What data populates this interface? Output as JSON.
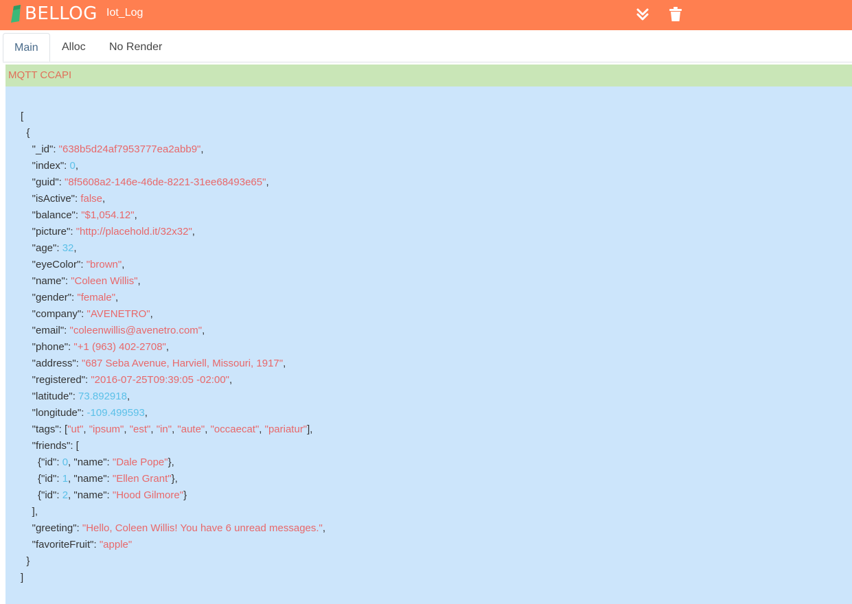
{
  "app": {
    "logo_text": "BELLOG",
    "title": "Iot_Log",
    "brand_color": "#ff7f50",
    "icons": {
      "scroll": "double-chevron-down-icon",
      "clear": "trash-icon"
    }
  },
  "tabs": [
    {
      "label": "Main",
      "active": true
    },
    {
      "label": "Alloc",
      "active": false
    },
    {
      "label": "No Render",
      "active": false
    }
  ],
  "panel": {
    "header": "MQTT CCAPI",
    "header_color": "#c9e6b7",
    "body_color": "#cce5fb"
  },
  "json_lines": [
    [
      {
        "t": "p",
        "v": "["
      }
    ],
    [
      {
        "t": "p",
        "v": "  {"
      }
    ],
    [
      {
        "t": "p",
        "v": "    \"_id\": "
      },
      {
        "t": "s",
        "v": "\"638b5d24af7953777ea2abb9\""
      },
      {
        "t": "p",
        "v": ","
      }
    ],
    [
      {
        "t": "p",
        "v": "    \"index\": "
      },
      {
        "t": "n",
        "v": "0"
      },
      {
        "t": "p",
        "v": ","
      }
    ],
    [
      {
        "t": "p",
        "v": "    \"guid\": "
      },
      {
        "t": "s",
        "v": "\"8f5608a2-146e-46de-8221-31ee68493e65\""
      },
      {
        "t": "p",
        "v": ","
      }
    ],
    [
      {
        "t": "p",
        "v": "    \"isActive\": "
      },
      {
        "t": "b",
        "v": "false"
      },
      {
        "t": "p",
        "v": ","
      }
    ],
    [
      {
        "t": "p",
        "v": "    \"balance\": "
      },
      {
        "t": "s",
        "v": "\"$1,054.12\""
      },
      {
        "t": "p",
        "v": ","
      }
    ],
    [
      {
        "t": "p",
        "v": "    \"picture\": "
      },
      {
        "t": "s",
        "v": "\"http://placehold.it/32x32\""
      },
      {
        "t": "p",
        "v": ","
      }
    ],
    [
      {
        "t": "p",
        "v": "    \"age\": "
      },
      {
        "t": "n",
        "v": "32"
      },
      {
        "t": "p",
        "v": ","
      }
    ],
    [
      {
        "t": "p",
        "v": "    \"eyeColor\": "
      },
      {
        "t": "s",
        "v": "\"brown\""
      },
      {
        "t": "p",
        "v": ","
      }
    ],
    [
      {
        "t": "p",
        "v": "    \"name\": "
      },
      {
        "t": "s",
        "v": "\"Coleen Willis\""
      },
      {
        "t": "p",
        "v": ","
      }
    ],
    [
      {
        "t": "p",
        "v": "    \"gender\": "
      },
      {
        "t": "s",
        "v": "\"female\""
      },
      {
        "t": "p",
        "v": ","
      }
    ],
    [
      {
        "t": "p",
        "v": "    \"company\": "
      },
      {
        "t": "s",
        "v": "\"AVENETRO\""
      },
      {
        "t": "p",
        "v": ","
      }
    ],
    [
      {
        "t": "p",
        "v": "    \"email\": "
      },
      {
        "t": "s",
        "v": "\"coleenwillis@avenetro.com\""
      },
      {
        "t": "p",
        "v": ","
      }
    ],
    [
      {
        "t": "p",
        "v": "    \"phone\": "
      },
      {
        "t": "s",
        "v": "\"+1 (963) 402-2708\""
      },
      {
        "t": "p",
        "v": ","
      }
    ],
    [
      {
        "t": "p",
        "v": "    \"address\": "
      },
      {
        "t": "s",
        "v": "\"687 Seba Avenue, Harviell, Missouri, 1917\""
      },
      {
        "t": "p",
        "v": ","
      }
    ],
    [
      {
        "t": "p",
        "v": "    \"registered\": "
      },
      {
        "t": "s",
        "v": "\"2016-07-25T09:39:05 -02:00\""
      },
      {
        "t": "p",
        "v": ","
      }
    ],
    [
      {
        "t": "p",
        "v": "    \"latitude\": "
      },
      {
        "t": "n",
        "v": "73.892918"
      },
      {
        "t": "p",
        "v": ","
      }
    ],
    [
      {
        "t": "p",
        "v": "    \"longitude\": "
      },
      {
        "t": "n",
        "v": "-109.499593"
      },
      {
        "t": "p",
        "v": ","
      }
    ],
    [
      {
        "t": "p",
        "v": "    \"tags\": ["
      },
      {
        "t": "s",
        "v": "\"ut\""
      },
      {
        "t": "p",
        "v": ", "
      },
      {
        "t": "s",
        "v": "\"ipsum\""
      },
      {
        "t": "p",
        "v": ", "
      },
      {
        "t": "s",
        "v": "\"est\""
      },
      {
        "t": "p",
        "v": ", "
      },
      {
        "t": "s",
        "v": "\"in\""
      },
      {
        "t": "p",
        "v": ", "
      },
      {
        "t": "s",
        "v": "\"aute\""
      },
      {
        "t": "p",
        "v": ", "
      },
      {
        "t": "s",
        "v": "\"occaecat\""
      },
      {
        "t": "p",
        "v": ", "
      },
      {
        "t": "s",
        "v": "\"pariatur\""
      },
      {
        "t": "p",
        "v": "],"
      }
    ],
    [
      {
        "t": "p",
        "v": "    \"friends\": ["
      }
    ],
    [
      {
        "t": "p",
        "v": "      {\"id\": "
      },
      {
        "t": "n",
        "v": "0"
      },
      {
        "t": "p",
        "v": ", \"name\": "
      },
      {
        "t": "s",
        "v": "\"Dale Pope\""
      },
      {
        "t": "p",
        "v": "},"
      }
    ],
    [
      {
        "t": "p",
        "v": "      {\"id\": "
      },
      {
        "t": "n",
        "v": "1"
      },
      {
        "t": "p",
        "v": ", \"name\": "
      },
      {
        "t": "s",
        "v": "\"Ellen Grant\""
      },
      {
        "t": "p",
        "v": "},"
      }
    ],
    [
      {
        "t": "p",
        "v": "      {\"id\": "
      },
      {
        "t": "n",
        "v": "2"
      },
      {
        "t": "p",
        "v": ", \"name\": "
      },
      {
        "t": "s",
        "v": "\"Hood Gilmore\""
      },
      {
        "t": "p",
        "v": "}"
      }
    ],
    [
      {
        "t": "p",
        "v": "    ],"
      }
    ],
    [
      {
        "t": "p",
        "v": "    \"greeting\": "
      },
      {
        "t": "s",
        "v": "\"Hello, Coleen Willis! You have 6 unread messages.\""
      },
      {
        "t": "p",
        "v": ","
      }
    ],
    [
      {
        "t": "p",
        "v": "    \"favoriteFruit\": "
      },
      {
        "t": "s",
        "v": "\"apple\""
      }
    ],
    [
      {
        "t": "p",
        "v": "  }"
      }
    ],
    [
      {
        "t": "p",
        "v": "]"
      }
    ]
  ]
}
